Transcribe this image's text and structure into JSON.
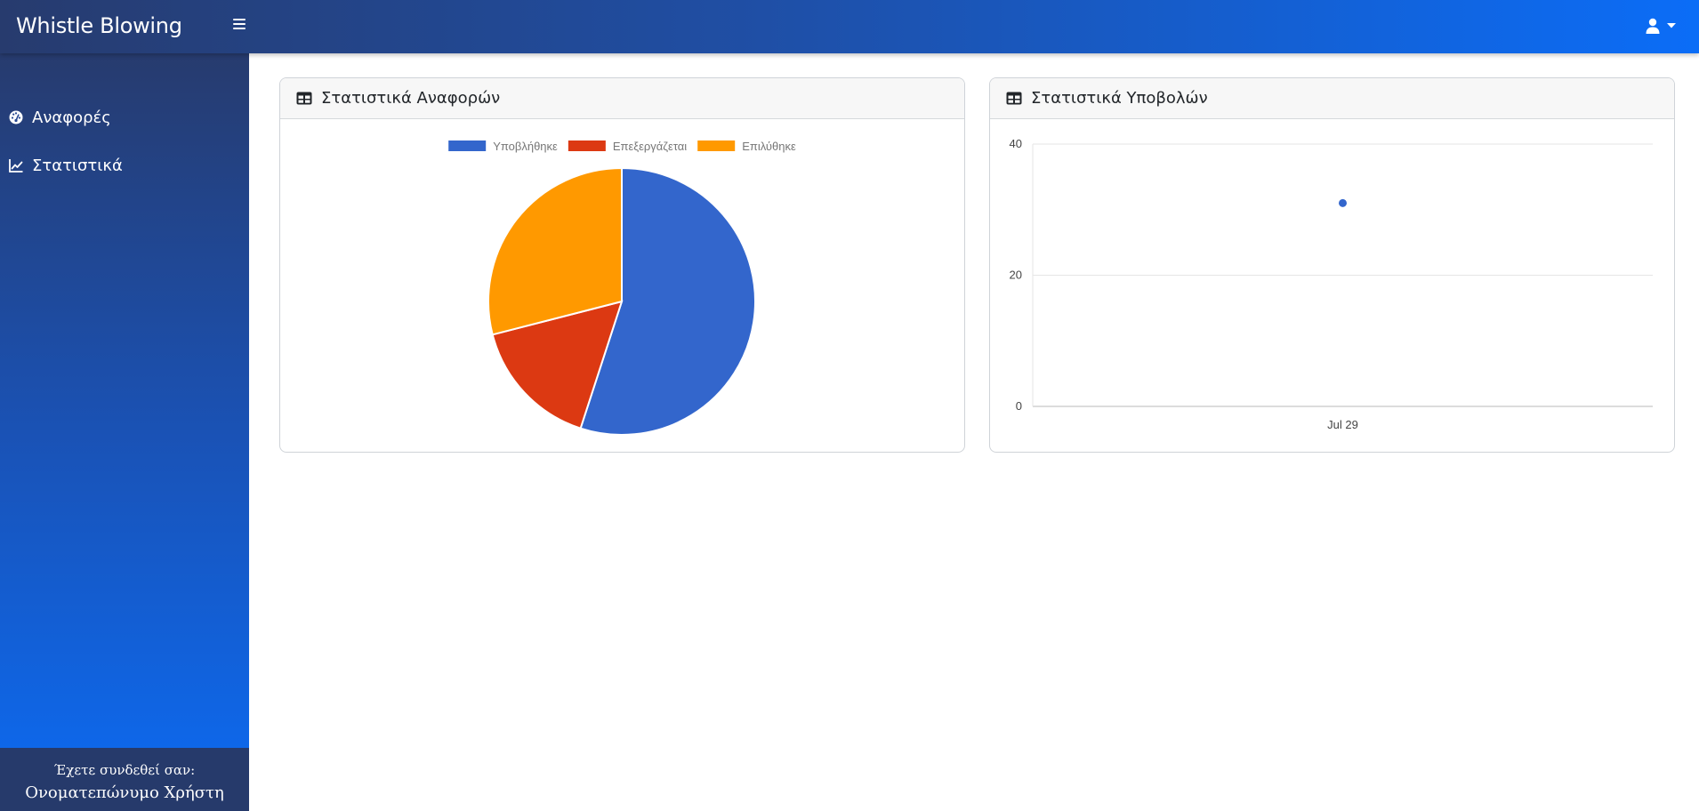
{
  "app": {
    "title": "Whistle Blowing"
  },
  "sidebar": {
    "items": [
      {
        "label": "Αναφορές",
        "icon": "dashboard-gauge-icon"
      },
      {
        "label": "Στατιστικά",
        "icon": "chart-line-icon"
      }
    ],
    "footer": {
      "label": "Έχετε συνδεθεί σαν:",
      "user_name": "Ονοματεπώνυμο Χρήστη"
    }
  },
  "cards": {
    "reports": {
      "title": "Στατιστικά Αναφορών",
      "icon": "table-icon"
    },
    "submissions": {
      "title": "Στατιστικά Υποβολών",
      "icon": "table-icon"
    }
  },
  "colors": {
    "submitted": "#3366cc",
    "processing": "#dc3912",
    "resolved": "#ff9900"
  },
  "chart_data": [
    {
      "type": "pie",
      "legend_position": "top",
      "categories": [
        "Υποβλήθηκε",
        "Επεξεργάζεται",
        "Επιλύθηκε"
      ],
      "values": [
        55,
        16,
        29
      ],
      "colors": [
        "#3366cc",
        "#dc3912",
        "#ff9900"
      ]
    },
    {
      "type": "scatter",
      "grid": true,
      "x_ticks": [
        "Jul 29"
      ],
      "y_ticks": [
        0,
        20,
        40
      ],
      "ylim": [
        0,
        40
      ],
      "series": [
        {
          "x": [
            "Jul 29"
          ],
          "y": [
            31
          ],
          "color": "#3366cc"
        }
      ]
    }
  ]
}
